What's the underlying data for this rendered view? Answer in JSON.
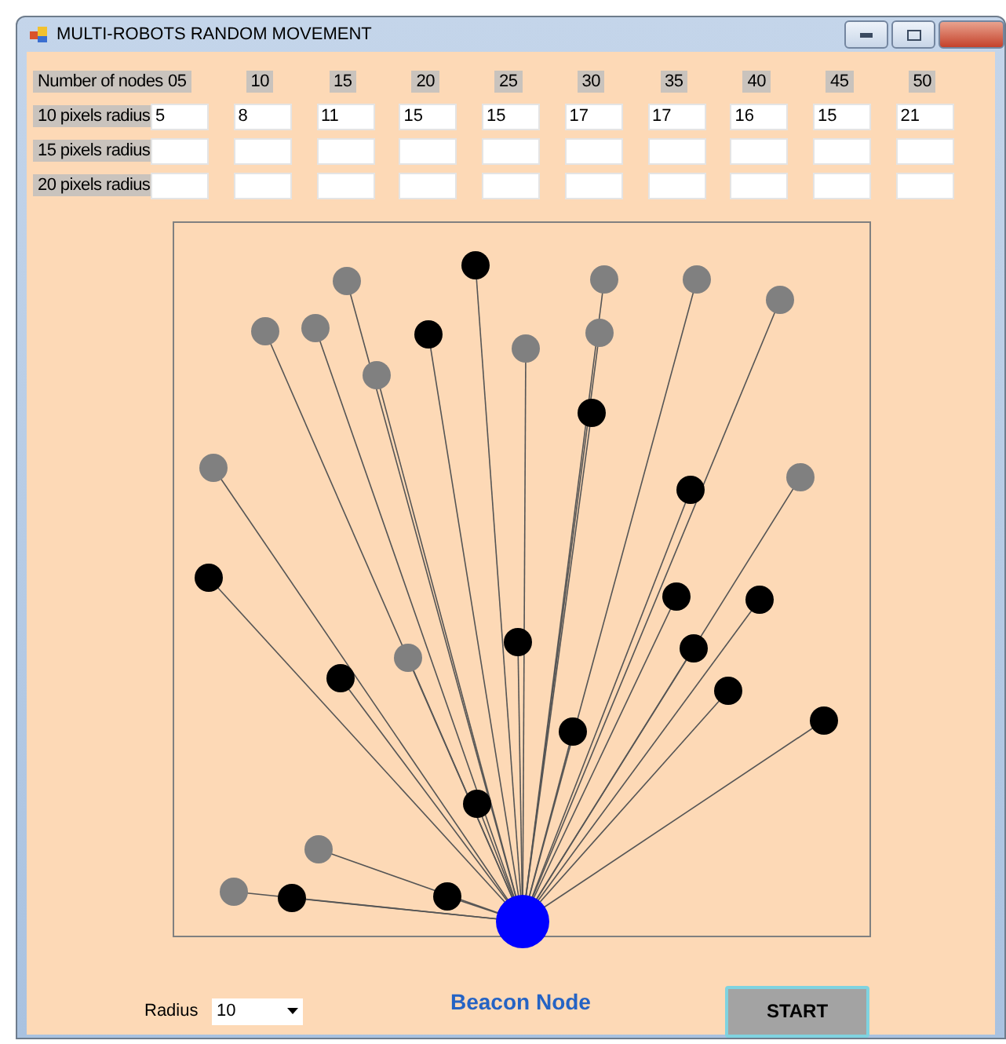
{
  "window": {
    "title": "MULTI-ROBOTS RANDOM MOVEMENT"
  },
  "grid": {
    "header_label": "Number of nodes",
    "columns": [
      "05",
      "10",
      "15",
      "20",
      "25",
      "30",
      "35",
      "40",
      "45",
      "50"
    ],
    "rows": [
      {
        "label": "10 pixels radius",
        "values": [
          "5",
          "8",
          "11",
          "15",
          "15",
          "17",
          "17",
          "16",
          "15",
          "21"
        ]
      },
      {
        "label": "15 pixels radius"
      },
      {
        "label": "20 pixels radius"
      }
    ]
  },
  "diagram": {
    "nodes": [
      {
        "color": "#808080"
      },
      {
        "color": "#808080"
      },
      {
        "color": "#808080"
      },
      {
        "color": "#808080"
      },
      {
        "color": "#808080"
      },
      {
        "color": "#808080"
      },
      {
        "color": "#808080"
      },
      {
        "color": "#808080"
      },
      {
        "color": "#808080"
      },
      {
        "color": "#808080"
      },
      {
        "color": "#808080"
      },
      {
        "color": "#808080"
      },
      {
        "color": "#808080"
      },
      {
        "color": "#808080"
      },
      {
        "color": "#000000"
      },
      {
        "color": "#000000"
      },
      {
        "color": "#000000"
      },
      {
        "color": "#000000"
      },
      {
        "color": "#000000"
      },
      {
        "color": "#000000"
      },
      {
        "color": "#000000"
      },
      {
        "color": "#000000"
      },
      {
        "color": "#000000"
      },
      {
        "color": "#000000"
      },
      {
        "color": "#000000"
      },
      {
        "color": "#000000"
      },
      {
        "color": "#000000"
      },
      {
        "color": "#000000"
      },
      {
        "color": "#000000"
      },
      {
        "color": "#000000"
      }
    ],
    "beacon": {
      "color": "#0000ff",
      "label": "Beacon Node"
    }
  },
  "footer": {
    "radius_label": "Radius",
    "radius_value": "10",
    "start_button": "START"
  }
}
